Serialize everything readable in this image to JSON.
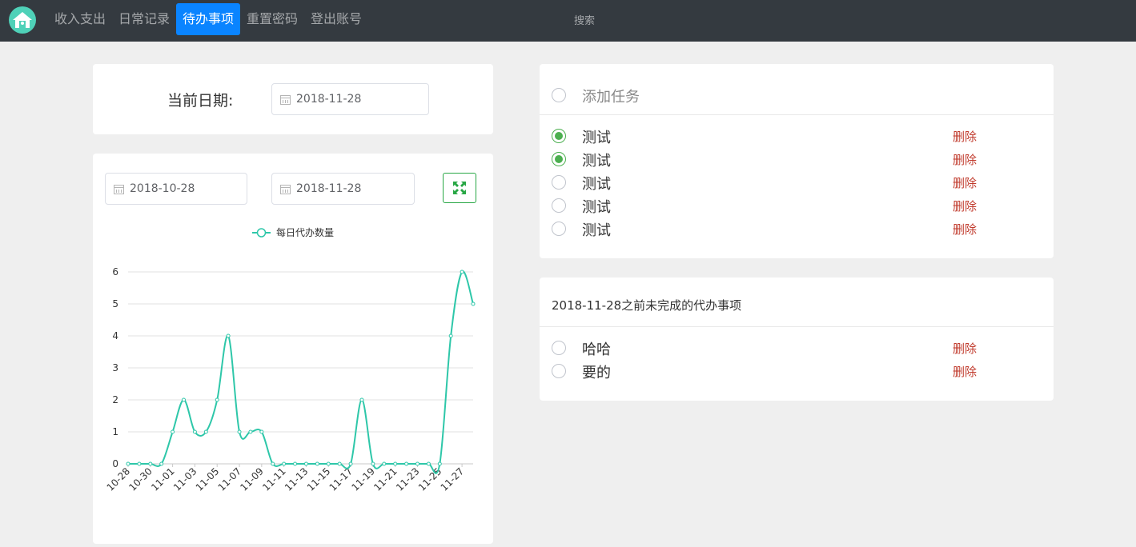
{
  "nav": {
    "logo_icon": "home-logo-icon",
    "items": [
      {
        "label": "收入支出",
        "active": false
      },
      {
        "label": "日常记录",
        "active": false
      },
      {
        "label": "待办事项",
        "active": true
      },
      {
        "label": "重置密码",
        "active": false
      },
      {
        "label": "登出账号",
        "active": false
      }
    ],
    "search_label": "搜索"
  },
  "current_date": {
    "label": "当前日期:",
    "value": "2018-11-28"
  },
  "range": {
    "start": "2018-10-28",
    "end": "2018-11-28",
    "expand_icon": "expand-icon"
  },
  "chart_data": {
    "type": "line",
    "legend": [
      "每日代办数量"
    ],
    "legend_position": "top-center",
    "color": "#2ec7a9",
    "x": [
      "10-28",
      "10-29",
      "10-30",
      "10-31",
      "11-01",
      "11-02",
      "11-03",
      "11-04",
      "11-05",
      "11-06",
      "11-07",
      "11-08",
      "11-09",
      "11-10",
      "11-11",
      "11-12",
      "11-13",
      "11-14",
      "11-15",
      "11-16",
      "11-17",
      "11-18",
      "11-19",
      "11-20",
      "11-21",
      "11-22",
      "11-23",
      "11-24",
      "11-25",
      "11-26",
      "11-27",
      "11-28"
    ],
    "x_tick_labels": [
      "10-28",
      "10-30",
      "11-01",
      "11-03",
      "11-05",
      "11-07",
      "11-09",
      "11-11",
      "11-13",
      "11-15",
      "11-17",
      "11-19",
      "11-21",
      "11-23",
      "11-25",
      "11-27"
    ],
    "series": [
      {
        "name": "每日代办数量",
        "values": [
          0,
          0,
          0,
          0,
          1,
          2,
          1,
          1,
          2,
          4,
          1,
          1,
          1,
          0,
          0,
          0,
          0,
          0,
          0,
          0,
          0,
          2,
          0,
          0,
          0,
          0,
          0,
          0,
          0,
          4,
          6,
          5
        ]
      }
    ],
    "ylim": [
      0,
      6
    ],
    "y_ticks": [
      0,
      1,
      2,
      3,
      4,
      5,
      6
    ],
    "grid": true,
    "smooth": true
  },
  "tasks": {
    "add_placeholder": "添加任务",
    "items": [
      {
        "text": "测试",
        "done": true,
        "delete_label": "删除"
      },
      {
        "text": "测试",
        "done": true,
        "delete_label": "删除"
      },
      {
        "text": "测试",
        "done": false,
        "delete_label": "删除"
      },
      {
        "text": "测试",
        "done": false,
        "delete_label": "删除"
      },
      {
        "text": "测试",
        "done": false,
        "delete_label": "删除"
      }
    ]
  },
  "overdue": {
    "title": "2018-11-28之前未完成的代办事项",
    "items": [
      {
        "text": "哈哈",
        "done": false,
        "delete_label": "删除"
      },
      {
        "text": "要的",
        "done": false,
        "delete_label": "删除"
      }
    ]
  }
}
